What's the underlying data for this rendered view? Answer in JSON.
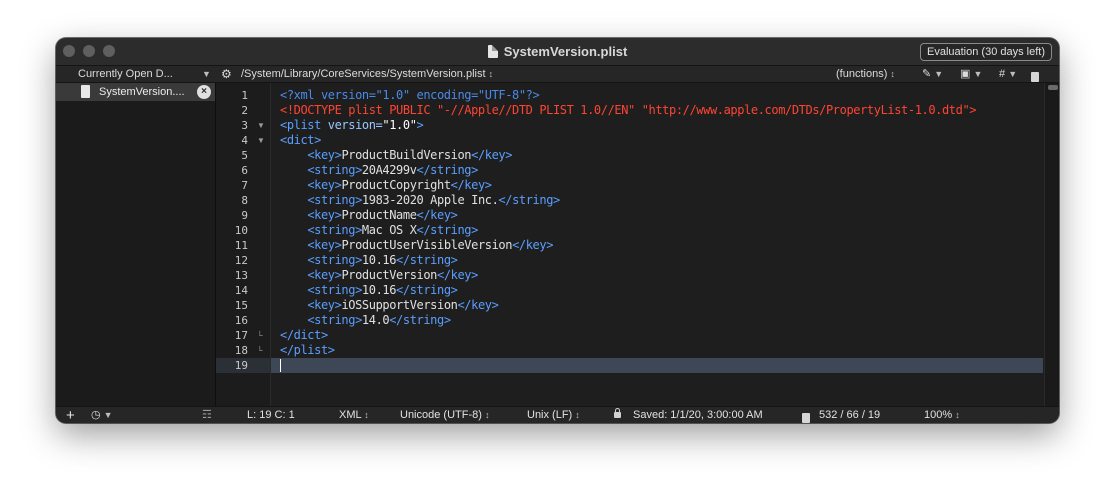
{
  "window": {
    "title": "SystemVersion.plist",
    "evaluation_label": "Evaluation (30 days left)"
  },
  "toolbar": {
    "open_documents_label": "Currently Open D...",
    "path": "/System/Library/CoreServices/SystemVersion.plist",
    "functions_label": "(functions)",
    "hash_label": "#"
  },
  "sidebar": {
    "items": [
      {
        "label": "SystemVersion...."
      }
    ]
  },
  "editor": {
    "line_numbers": [
      "1",
      "2",
      "3",
      "4",
      "5",
      "6",
      "7",
      "8",
      "9",
      "10",
      "11",
      "12",
      "13",
      "14",
      "15",
      "16",
      "17",
      "18",
      "19"
    ],
    "lines": [
      "<?xml version=\"1.0\" encoding=\"UTF-8\"?>",
      "<!DOCTYPE plist PUBLIC \"-//Apple//DTD PLIST 1.0//EN\" \"http://www.apple.com/DTDs/PropertyList-1.0.dtd\">",
      "<plist version=\"1.0\">",
      "<dict>",
      "    <key>ProductBuildVersion</key>",
      "    <string>20A4299v</string>",
      "    <key>ProductCopyright</key>",
      "    <string>1983-2020 Apple Inc.</string>",
      "    <key>ProductName</key>",
      "    <string>Mac OS X</string>",
      "    <key>ProductUserVisibleVersion</key>",
      "    <string>10.16</string>",
      "    <key>ProductVersion</key>",
      "    <string>10.16</string>",
      "    <key>iOSSupportVersion</key>",
      "    <string>14.0</string>",
      "</dict>",
      "</plist>",
      ""
    ]
  },
  "statusbar": {
    "position": "L: 19 C: 1",
    "language": "XML",
    "encoding": "Unicode (UTF-8)",
    "line_endings": "Unix (LF)",
    "saved": "Saved: 1/1/20, 3:00:00 AM",
    "counts": "532 / 66 / 19",
    "zoom": "100%"
  },
  "icons": {
    "sidebar_add": "plus-icon",
    "sidebar_history": "clock-icon",
    "sidebar_panel": "columns-icon",
    "settings": "gear-icon",
    "pencil": "pencil-icon",
    "document": "document-icon",
    "lock": "lock-icon"
  }
}
